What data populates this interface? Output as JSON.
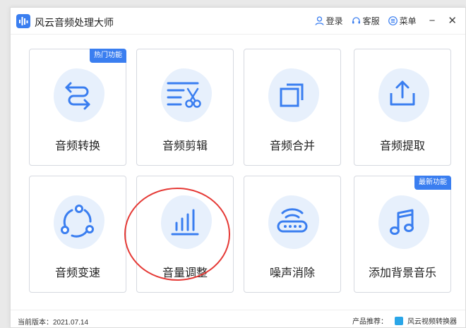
{
  "app": {
    "title": "风云音频处理大师"
  },
  "header": {
    "login": "登录",
    "service": "客服",
    "menu": "菜单",
    "minimize": "−",
    "close": "✕"
  },
  "cards": [
    {
      "label": "音频转换",
      "badge": "热门功能",
      "icon": "convert-arrows-icon"
    },
    {
      "label": "音频剪辑",
      "badge": "",
      "icon": "scissors-icon"
    },
    {
      "label": "音频合并",
      "badge": "",
      "icon": "merge-squares-icon"
    },
    {
      "label": "音频提取",
      "badge": "",
      "icon": "upload-tray-icon"
    },
    {
      "label": "音频变速",
      "badge": "",
      "icon": "speed-circle-icon"
    },
    {
      "label": "音量调整",
      "badge": "",
      "icon": "volume-bars-icon"
    },
    {
      "label": "噪声消除",
      "badge": "",
      "icon": "noise-router-icon"
    },
    {
      "label": "添加背景音乐",
      "badge": "最新功能",
      "icon": "music-note-icon"
    }
  ],
  "footer": {
    "version": "当前版本：2021.07.14",
    "recommend_label": "产品推荐：",
    "recommend_product": "风云视频转换器"
  },
  "colors": {
    "accent": "#3a7ef0",
    "blob": "#e7f0fc",
    "highlight": "#e53935"
  }
}
